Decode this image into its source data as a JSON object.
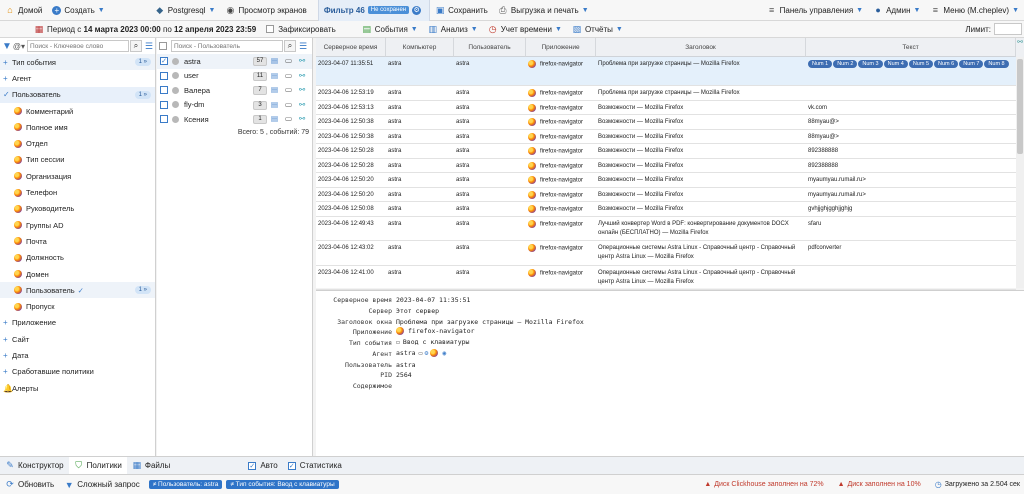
{
  "topbar": {
    "home": "Домой",
    "create": "Создать",
    "db": "Postgresql",
    "screens": "Просмотр экранов",
    "filter_tab": "Фильтр 46",
    "filter_badge": "Не сохранен",
    "save": "Сохранить",
    "export": "Выгрузка и печать",
    "control_panel": "Панель управления",
    "admin": "Админ",
    "menu": "Меню (M.cheplev)"
  },
  "bar2": {
    "period_prefix": "Период с",
    "period_from": "14 марта 2023 00:00",
    "period_mid": "по",
    "period_to": "12 апреля 2023 23:59",
    "fixed": "Зафиксировать",
    "events": "События",
    "analysis": "Анализ",
    "time_accounting": "Учет времени",
    "reports": "Отчёты",
    "limit_label": "Лимит:"
  },
  "left": {
    "search_placeholder": "Поиск - Ключевое слово",
    "items": [
      {
        "label": "Тип события",
        "badge": "1 »"
      },
      {
        "label": "Агент"
      },
      {
        "label": "Пользователь",
        "badge": "1 »"
      },
      {
        "label": "Комментарий"
      },
      {
        "label": "Полное имя"
      },
      {
        "label": "Отдел"
      },
      {
        "label": "Тип сессии"
      },
      {
        "label": "Организация"
      },
      {
        "label": "Телефон"
      },
      {
        "label": "Руководитель"
      },
      {
        "label": "Группы AD"
      },
      {
        "label": "Почта"
      },
      {
        "label": "Должность"
      },
      {
        "label": "Домен"
      },
      {
        "label": "Пользователь",
        "badge": "1 »"
      },
      {
        "label": "Пропуск"
      },
      {
        "label": "Приложение"
      },
      {
        "label": "Сайт"
      },
      {
        "label": "Дата"
      },
      {
        "label": "Сработавшие политики"
      },
      {
        "label": "Алерты"
      }
    ]
  },
  "middle": {
    "search_placeholder": "Поиск - Пользователь",
    "users": [
      {
        "name": "astra",
        "count": "57"
      },
      {
        "name": "user",
        "count": "11"
      },
      {
        "name": "Валера",
        "count": "7"
      },
      {
        "name": "fly-dm",
        "count": "3"
      },
      {
        "name": "Ксения",
        "count": "1"
      }
    ],
    "total": "Всего: 5 , событий: 79"
  },
  "grid": {
    "headers": [
      "Серверное время",
      "Компьютер",
      "Пользователь",
      "Приложение",
      "Заголовок",
      "Текст"
    ],
    "pills": [
      "Num 1",
      "Num 2",
      "Num 3",
      "Num 4",
      "Num 5",
      "Num 6",
      "Num 7",
      "Num 8"
    ],
    "rows": [
      {
        "time": "2023-04-07 11:35:51",
        "pc": "astra",
        "user": "astra",
        "app": "firefox-navigator",
        "title": "Проблема при загрузке страницы — Mozilla Firefox",
        "text": ""
      },
      {
        "time": "2023-04-06 12:53:19",
        "pc": "astra",
        "user": "astra",
        "app": "firefox-navigator",
        "title": "Проблема при загрузке страницы — Mozilla Firefox",
        "text": ""
      },
      {
        "time": "2023-04-06 12:53:13",
        "pc": "astra",
        "user": "astra",
        "app": "firefox-navigator",
        "title": "Возможности — Mozilla Firefox",
        "text": "vk.com"
      },
      {
        "time": "2023-04-06 12:50:38",
        "pc": "astra",
        "user": "astra",
        "app": "firefox-navigator",
        "title": "Возможности — Mozilla Firefox",
        "text": "88myau@>"
      },
      {
        "time": "2023-04-06 12:50:38",
        "pc": "astra",
        "user": "astra",
        "app": "firefox-navigator",
        "title": "Возможности — Mozilla Firefox",
        "text": "88myau@>"
      },
      {
        "time": "2023-04-06 12:50:28",
        "pc": "astra",
        "user": "astra",
        "app": "firefox-navigator",
        "title": "Возможности — Mozilla Firefox",
        "text": "892388888"
      },
      {
        "time": "2023-04-06 12:50:28",
        "pc": "astra",
        "user": "astra",
        "app": "firefox-navigator",
        "title": "Возможности — Mozilla Firefox",
        "text": "892388888"
      },
      {
        "time": "2023-04-06 12:50:20",
        "pc": "astra",
        "user": "astra",
        "app": "firefox-navigator",
        "title": "Возможности — Mozilla Firefox",
        "text": "myaumyau.rumail.ru>"
      },
      {
        "time": "2023-04-06 12:50:20",
        "pc": "astra",
        "user": "astra",
        "app": "firefox-navigator",
        "title": "Возможности — Mozilla Firefox",
        "text": "myaumyau.rumail.ru>"
      },
      {
        "time": "2023-04-06 12:50:08",
        "pc": "astra",
        "user": "astra",
        "app": "firefox-navigator",
        "title": "Возможности — Mozilla Firefox",
        "text": "gvhjjghjgghjjghjg"
      },
      {
        "time": "2023-04-06 12:49:43",
        "pc": "astra",
        "user": "astra",
        "app": "firefox-navigator",
        "title": "Лучший конвертер Word в PDF: конвертирование документов DOCX онлайн (БЕСПЛАТНО) — Mozilla Firefox",
        "text": "sfaru"
      },
      {
        "time": "2023-04-06 12:43:02",
        "pc": "astra",
        "user": "astra",
        "app": "firefox-navigator",
        "title": "Операционные системы Astra Linux - Справочный центр - Справочный центр Astra Linux — Mozilla Firefox",
        "text": "pdfconverter"
      },
      {
        "time": "2023-04-06 12:41:00",
        "pc": "astra",
        "user": "astra",
        "app": "firefox-navigator",
        "title": "Операционные системы Astra Linux - Справочный центр - Справочный центр Astra Linux — Mozilla Firefox",
        "text": ""
      }
    ]
  },
  "detail": {
    "server_time_k": "Серверное время",
    "server_time_v": "2023-04-07 11:35:51",
    "server_k": "Сервер",
    "server_v": "Этот сервер",
    "title_k": "Заголовок окна",
    "title_v": "Проблема при загрузке страницы — Mozilla Firefox",
    "app_k": "Приложение",
    "app_v": "firefox-navigator",
    "type_k": "Тип события",
    "type_v": "Ввод с клавиатуры",
    "agent_k": "Агент",
    "agent_v": "astra",
    "user_k": "Пользователь",
    "user_v": "astra",
    "pid_k": "PID",
    "pid_v": "2564",
    "content_k": "Содержимое"
  },
  "bottom1": {
    "constructor": "Конструктор",
    "policies": "Политики",
    "files": "Файлы",
    "auto": "Авто",
    "stats": "Статистика"
  },
  "bottom2": {
    "refresh": "Обновить",
    "complex": "Сложный запрос",
    "chip1": "≠ Пользователь: astra",
    "chip2": "≠ Тип события: Ввод с клавиатуры",
    "warn1": "Диск Clickhouse заполнен на 72%",
    "warn2": "Диск заполнен на 10%",
    "loaded": "Загружено за 2.504 сек"
  },
  "colors": {
    "accent": "#3a7bc8",
    "pill": "#3d6db2",
    "warning": "#c0392b"
  }
}
